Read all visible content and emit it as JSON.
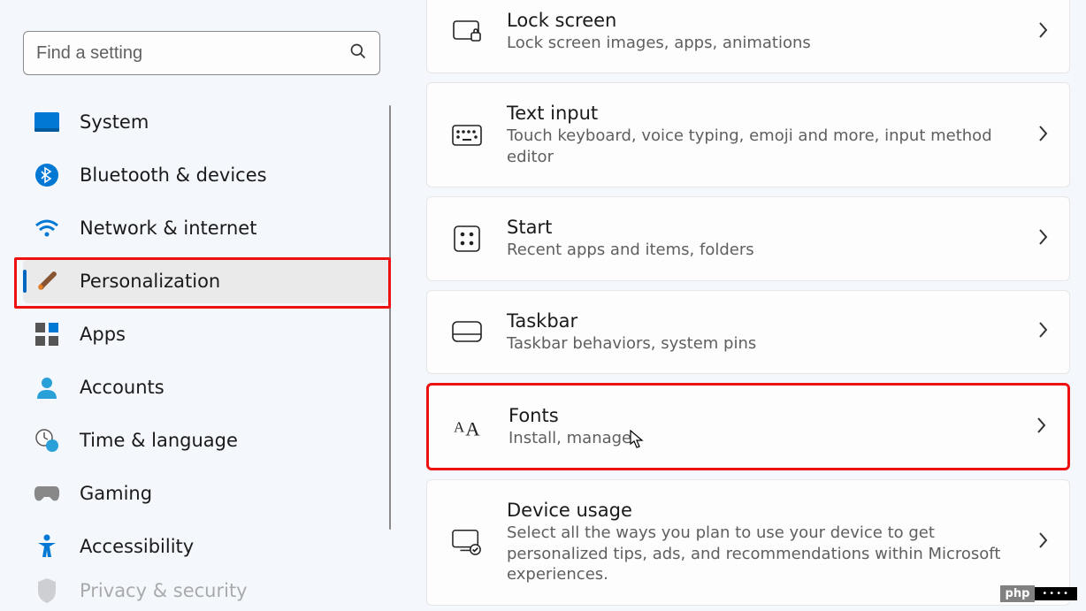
{
  "search": {
    "placeholder": "Find a setting"
  },
  "sidebar": {
    "items": [
      {
        "id": "system",
        "label": "System"
      },
      {
        "id": "bluetooth",
        "label": "Bluetooth & devices"
      },
      {
        "id": "network",
        "label": "Network & internet"
      },
      {
        "id": "personalization",
        "label": "Personalization",
        "selected": true,
        "highlight": true
      },
      {
        "id": "apps",
        "label": "Apps"
      },
      {
        "id": "accounts",
        "label": "Accounts"
      },
      {
        "id": "time",
        "label": "Time & language"
      },
      {
        "id": "gaming",
        "label": "Gaming"
      },
      {
        "id": "accessibility",
        "label": "Accessibility"
      },
      {
        "id": "privacy",
        "label": "Privacy & security"
      }
    ]
  },
  "cards": [
    {
      "id": "lock",
      "title": "Lock screen",
      "desc": "Lock screen images, apps, animations"
    },
    {
      "id": "textinput",
      "title": "Text input",
      "desc": "Touch keyboard, voice typing, emoji and more, input method editor"
    },
    {
      "id": "start",
      "title": "Start",
      "desc": "Recent apps and items, folders"
    },
    {
      "id": "taskbar",
      "title": "Taskbar",
      "desc": "Taskbar behaviors, system pins"
    },
    {
      "id": "fonts",
      "title": "Fonts",
      "desc": "Install, manage",
      "highlight": true
    },
    {
      "id": "deviceusage",
      "title": "Device usage",
      "desc": "Select all the ways you plan to use your device to get personalized tips, ads, and recommendations within Microsoft experiences."
    }
  ],
  "watermark": {
    "left": "php",
    "right": "••••"
  }
}
